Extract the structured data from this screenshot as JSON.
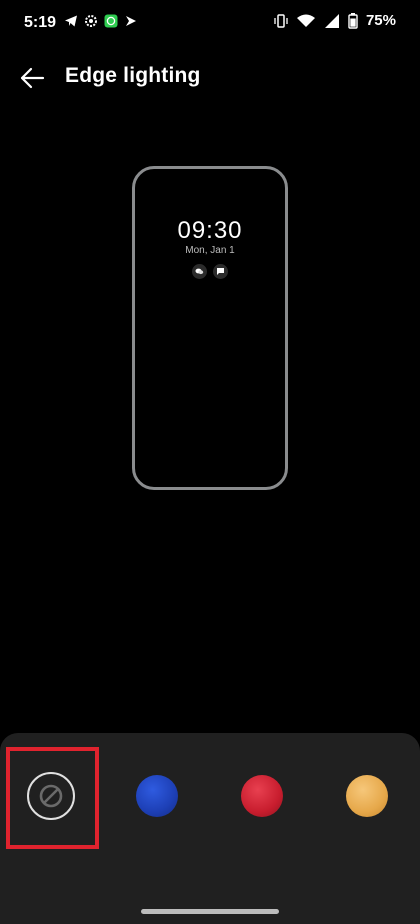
{
  "status_bar": {
    "time": "5:19",
    "left_icons": [
      "telegram-icon",
      "settings-icon",
      "whatsapp-icon",
      "feedly-icon"
    ],
    "right_icons": [
      "vibrate-icon",
      "wifi-icon",
      "signal-icon",
      "battery-icon"
    ],
    "battery_percent": "75%"
  },
  "app_bar": {
    "title": "Edge lighting",
    "back_icon": "arrow-back-icon"
  },
  "preview": {
    "time": "09:30",
    "date": "Mon, Jan 1",
    "notification_icons": [
      "wechat-icon",
      "message-icon"
    ]
  },
  "color_options": [
    {
      "name": "none",
      "icon": "no-symbol-icon",
      "selected": true
    },
    {
      "name": "blue",
      "color": "#1d3fb5"
    },
    {
      "name": "red",
      "color": "#c81d2e"
    },
    {
      "name": "gold",
      "color": "#e6a84a"
    }
  ],
  "colors": {
    "background": "#000000",
    "sheet": "#202020",
    "preview_border": "#8a8c8e",
    "highlight": "#e0232e"
  }
}
